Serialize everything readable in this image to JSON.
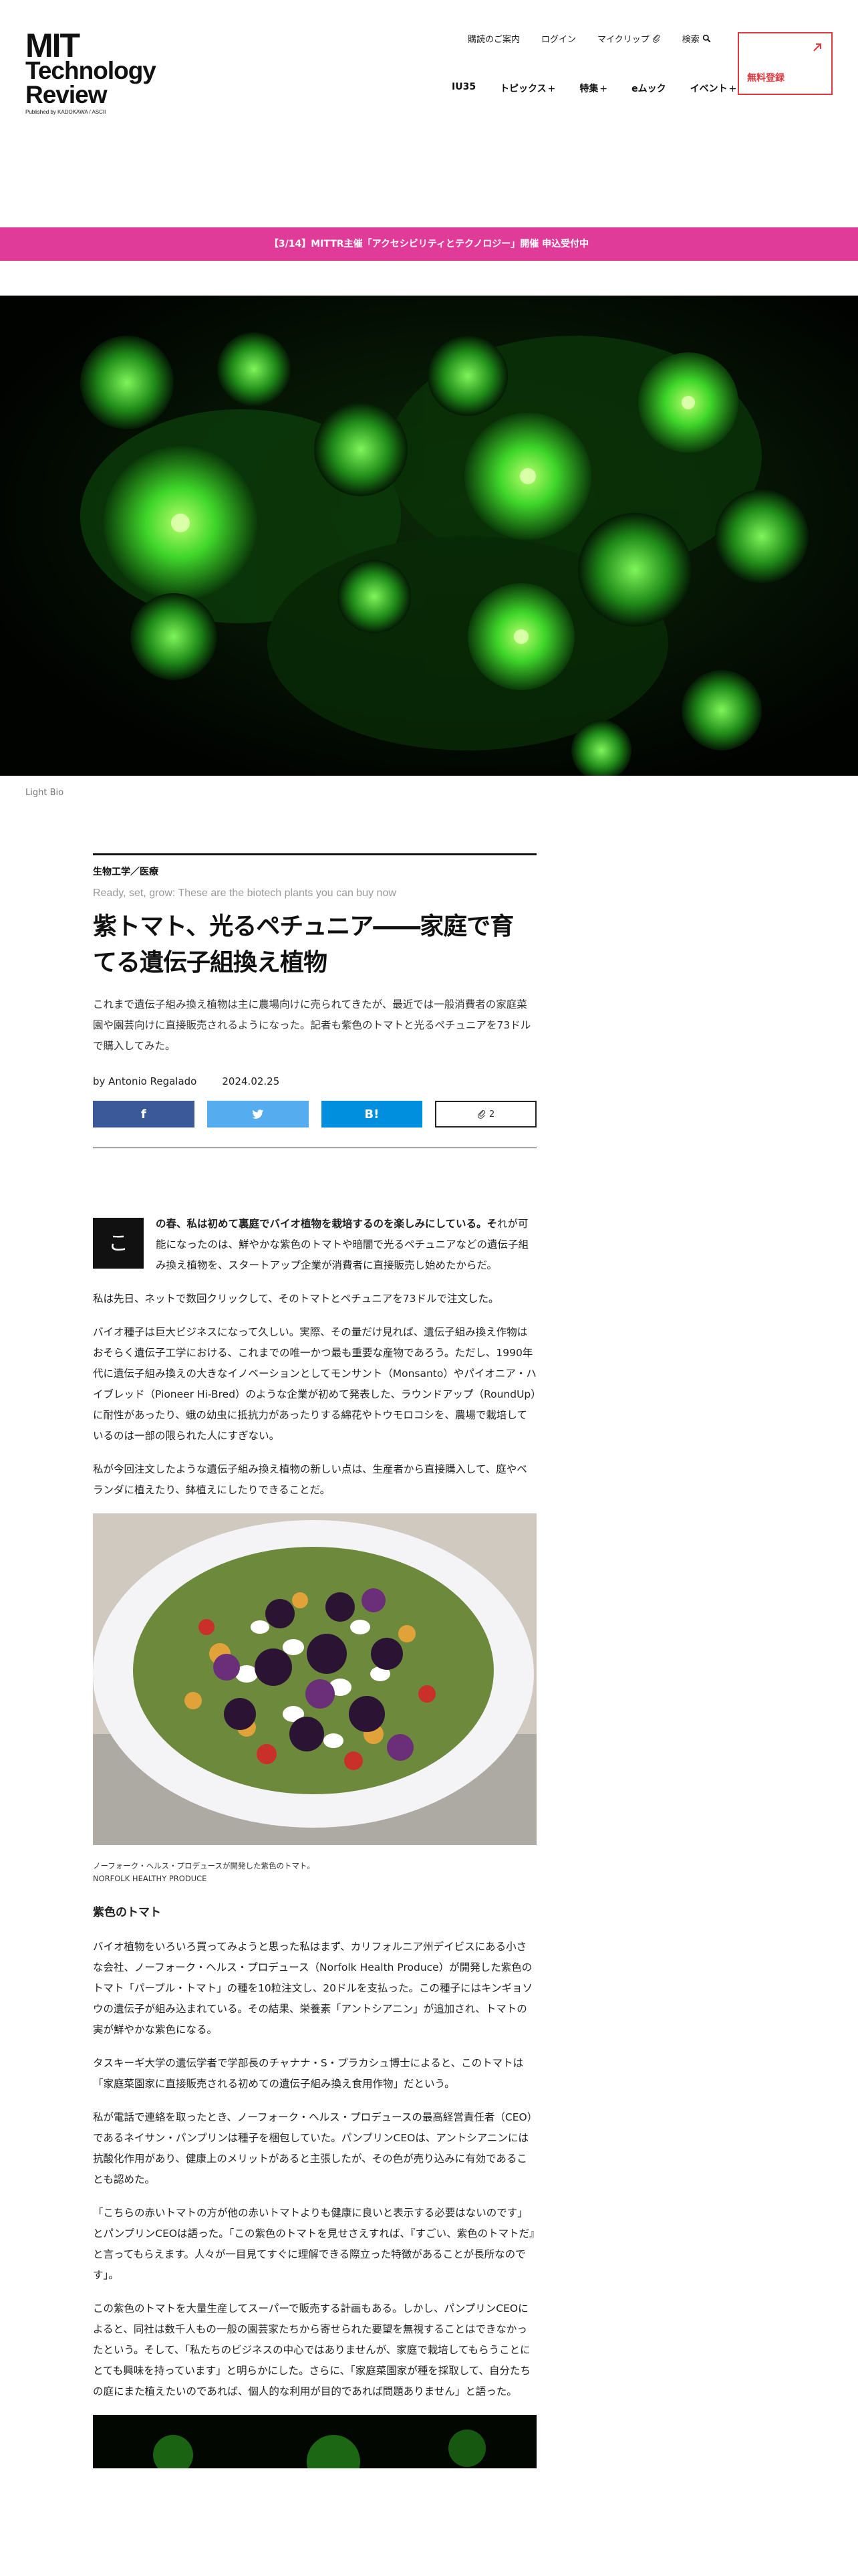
{
  "header": {
    "logo": {
      "line1": "MIT",
      "line2": "Technology",
      "line3": "Review",
      "tagline": "Published by KADOKAWA / ASCII"
    },
    "utility_nav": [
      "購読のご案内",
      "ログイン",
      "マイクリップ",
      "検索"
    ],
    "main_nav": [
      {
        "label": "IU35",
        "has_plus": false
      },
      {
        "label": "トピックス",
        "has_plus": true
      },
      {
        "label": "特集",
        "has_plus": true
      },
      {
        "label": "eムック",
        "has_plus": false
      },
      {
        "label": "イベント",
        "has_plus": true
      }
    ],
    "plus_symbol": "+",
    "register_label": "無料登録"
  },
  "banner": {
    "text": "【3/14】MITTR主催「アクセシビリティとテクノロジー」開催 申込受付中"
  },
  "hero": {
    "credit": "Light Bio"
  },
  "article": {
    "category": "生物工学／医療",
    "subtitle_en": "Ready, set, grow: These are the biotech plants you can buy now",
    "title": "紫トマト、光るペチュニア――家庭で育てる遺伝子組換え植物",
    "lede": "これまで遺伝子組み換え植物は主に農場向けに売られてきたが、最近では一般消費者の家庭菜園や園芸向けに直接販売されるようになった。記者も紫色のトマトと光るペチュニアを73ドルで購入してみた。",
    "author": "by Antonio Regalado",
    "date": "2024.02.25",
    "share": {
      "facebook": "f",
      "hatena": "B!",
      "clip_count": "2"
    },
    "dropcap": "こ",
    "first_para_strong": "の春、私は初めて裏庭でバイオ植物を栽培するのを楽しみにしている。そ",
    "first_para_rest": "れが可能になったのは、鮮やかな紫色のトマトや暗闇で光るペチュニアなどの遺伝子組み換え植物を、スタートアップ企業が消費者に直接販売し始めたからだ。",
    "paragraphs_a": [
      "私は先日、ネットで数回クリックして、そのトマトとペチュニアを73ドルで注文した。",
      "バイオ種子は巨大ビジネスになって久しい。実際、その量だけ見れば、遺伝子組み換え作物はおそらく遺伝子工学における、これまでの唯一かつ最も重要な産物であろう。ただし、1990年代に遺伝子組み換えの大きなイノベーションとしてモンサント（Monsanto）やパイオニア・ハイブレッド（Pioneer Hi-Bred）のような企業が初めて発表した、ラウンドアップ（RoundUp）に耐性があったり、蛾の幼虫に抵抗力があったりする綿花やトウモロコシを、農場で栽培しているのは一部の限られた人にすぎない。",
      "私が今回注文したような遺伝子組み換え植物の新しい点は、生産者から直接購入して、庭やベランダに植えたり、鉢植えにしたりできることだ。"
    ],
    "figure_caption_1": "ノーフォーク・ヘルス・プロデュースが開発した紫色のトマト。",
    "figure_caption_2": "NORFOLK HEALTHY PRODUCE",
    "section_heading": "紫色のトマト",
    "paragraphs_b": [
      "バイオ植物をいろいろ買ってみようと思った私はまず、カリフォルニア州デイビスにある小さな会社、ノーフォーク・ヘルス・プロデュース（Norfolk Health Produce）が開発した紫色のトマト「パープル・トマト」の種を10粒注文し、20ドルを支払った。この種子にはキンギョソウの遺伝子が組み込まれている。その結果、栄養素「アントシアニン」が追加され、トマトの実が鮮やかな紫色になる。",
      "タスキーギ大学の遺伝学者で学部長のチャナナ・S・プラカシュ博士によると、このトマトは「家庭菜園家に直接販売される初めての遺伝子組み換え食用作物」だという。",
      "私が電話で連絡を取ったとき、ノーフォーク・ヘルス・プロデュースの最高経営責任者（CEO）であるネイサン・パンプリンは種子を梱包していた。パンプリンCEOは、アントシアニンには抗酸化作用があり、健康上のメリットがあると主張したが、その色が売り込みに有効であることも認めた。",
      "「こちらの赤いトマトの方が他の赤いトマトよりも健康に良いと表示する必要はないのです」とパンプリンCEOは語った。「この紫色のトマトを見せさえすれば、『すごい、紫色のトマトだ』と言ってもらえます。人々が一目見てすぐに理解できる際立った特徴があることが長所なのです」。",
      "この紫色のトマトを大量生産してスーパーで販売する計画もある。しかし、パンプリンCEOによると、同社は数千人もの一般の園芸家たちから寄せられた要望を無視することはできなかったという。そして、「私たちのビジネスの中心ではありませんが、家庭で栽培してもらうことにとても興味を持っています」と明らかにした。さらに、「家庭菜園家が種を採取して、自分たちの庭にまた植えたいのであれば、個人的な利用が目的であれば問題ありません」と語った。"
    ]
  }
}
